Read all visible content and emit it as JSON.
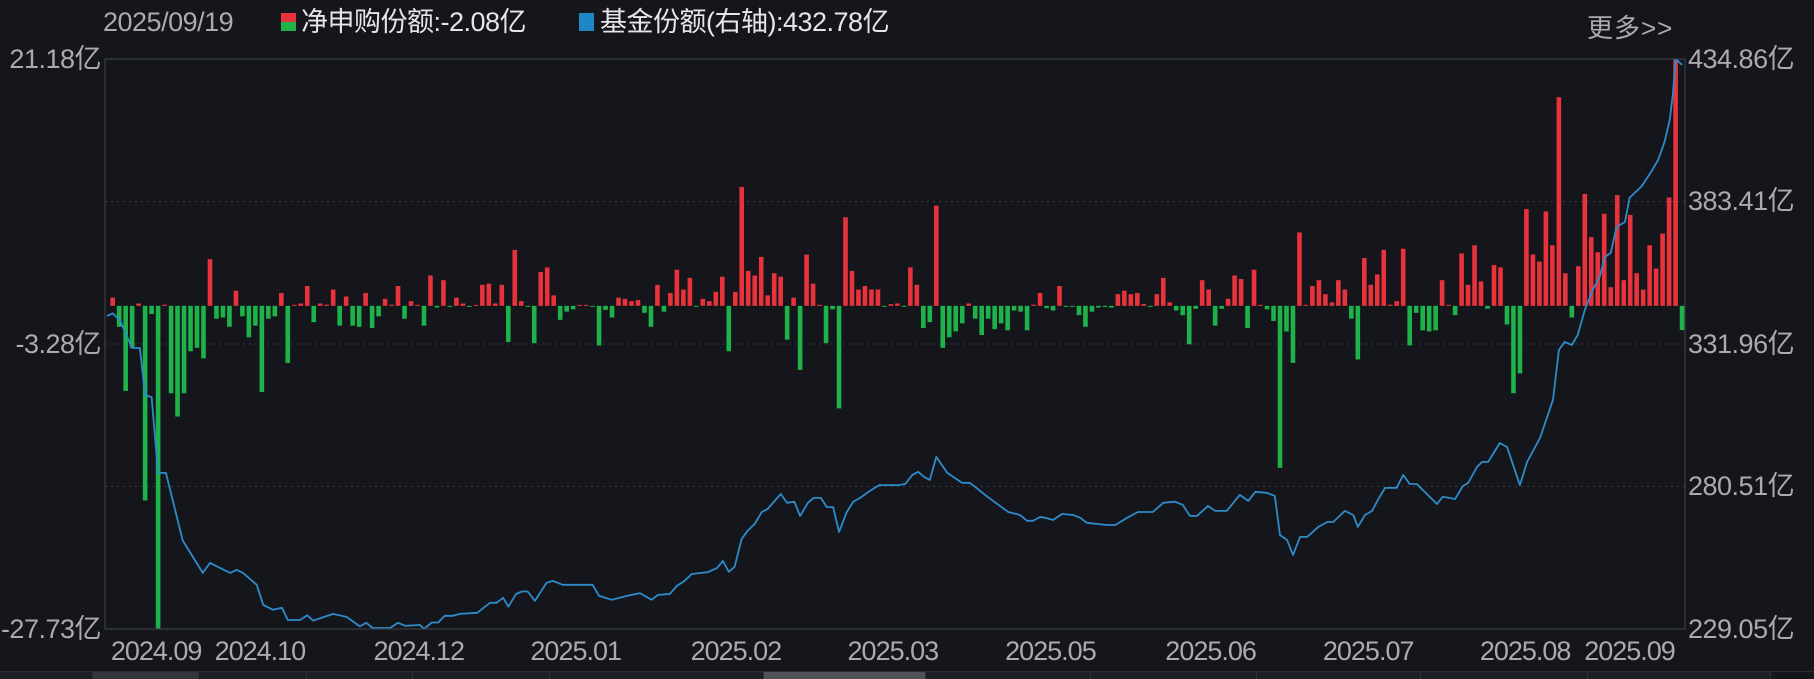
{
  "header": {
    "date": "2025/09/19",
    "net_purchase_label": "净申购份额:-2.08亿",
    "fund_share_label": "基金份额(右轴):432.78亿",
    "more_link": "更多>>"
  },
  "colors": {
    "positive": "#e8333c",
    "negative": "#1db34a",
    "line": "#2e8bc9",
    "grid": "#3a3d44",
    "background": "#14161b"
  },
  "chart_data": {
    "type": "bar+line",
    "title": "",
    "series": [
      {
        "name": "净申购份额",
        "type": "bar",
        "axis": "left",
        "unit": "亿",
        "values": [
          0.7,
          -1.8,
          -7.3,
          -3.6,
          0.2,
          -16.7,
          -0.7,
          -27.73,
          0.1,
          -7.5,
          -9.5,
          -7.5,
          -3.9,
          -3.6,
          -4.5,
          4.0,
          -1.1,
          -1.0,
          -1.8,
          1.3,
          -0.9,
          -2.7,
          -1.7,
          -7.4,
          -1.1,
          -0.9,
          1.1,
          -4.9,
          0.05,
          0.2,
          1.7,
          -1.4,
          0.2,
          0.1,
          1.4,
          -1.7,
          0.8,
          -1.7,
          -1.8,
          1.1,
          -1.9,
          -0.9,
          0.6,
          0.1,
          1.7,
          -1.1,
          0.4,
          0.05,
          -1.7,
          2.6,
          -0.15,
          2.2,
          -0.05,
          0.7,
          0.2,
          -0.05,
          0.05,
          1.8,
          1.9,
          0.2,
          1.8,
          -3.1,
          4.8,
          0.4,
          -0.05,
          -3.2,
          2.9,
          3.3,
          0.9,
          -1.2,
          -0.5,
          -0.3,
          0.05,
          0.05,
          -0.05,
          -3.4,
          -0.35,
          -1.0,
          0.7,
          0.6,
          0.4,
          0.5,
          -0.6,
          -1.8,
          1.8,
          -0.5,
          1.1,
          3.1,
          1.4,
          2.4,
          -0.05,
          0.6,
          0.4,
          1.2,
          2.5,
          -3.9,
          1.2,
          10.2,
          3.0,
          2.6,
          4.2,
          0.9,
          2.8,
          2.5,
          -2.9,
          0.7,
          -5.5,
          4.4,
          1.9,
          0.05,
          -3.2,
          -0.3,
          -8.8,
          7.6,
          3.0,
          1.4,
          1.7,
          1.4,
          1.4,
          -0.05,
          0.15,
          0.2,
          -0.05,
          3.3,
          1.8,
          -1.9,
          -1.4,
          8.6,
          -3.6,
          -2.7,
          -2.2,
          -1.5,
          0.2,
          -1.1,
          -2.5,
          -1.1,
          -2.0,
          -1.5,
          -2.1,
          -0.4,
          -0.5,
          -2.1,
          0.1,
          1.1,
          -0.2,
          -0.4,
          1.7,
          -0.05,
          -0.05,
          -0.8,
          -1.8,
          -0.5,
          -0.15,
          -0.1,
          -0.15,
          1.0,
          1.3,
          1.0,
          1.1,
          0.15,
          -0.05,
          1.0,
          2.4,
          0.3,
          -0.4,
          -0.8,
          -3.3,
          -0.25,
          2.2,
          1.4,
          -1.7,
          -0.25,
          0.6,
          2.6,
          2.3,
          -1.9,
          3.1,
          0.05,
          -0.3,
          -1.3,
          -13.9,
          -2.2,
          -4.9,
          6.3,
          0.05,
          1.7,
          2.2,
          1.0,
          0.3,
          2.2,
          1.4,
          -1.1,
          -4.6,
          4.1,
          1.8,
          2.7,
          4.8,
          0.1,
          0.4,
          4.9,
          -3.4,
          -0.6,
          -2.1,
          -2.2,
          -2.1,
          2.2,
          0.05,
          -0.8,
          4.5,
          1.8,
          5.2,
          2.1,
          -0.25,
          3.5,
          3.3,
          -1.6,
          -7.5,
          -5.8,
          8.3,
          4.4,
          3.8,
          8.1,
          5.2,
          17.9,
          2.8,
          -1.0,
          3.4,
          9.6,
          5.9,
          4.6,
          7.9,
          1.6,
          9.5,
          2.2,
          7.8,
          2.8,
          1.4,
          5.2,
          3.2,
          6.2,
          9.3,
          21.18,
          -2.08
        ]
      },
      {
        "name": "基金份额(右轴)",
        "type": "line",
        "axis": "right",
        "unit": "亿",
        "points": [
          [
            -0.9,
            342.1
          ],
          [
            0,
            343
          ],
          [
            1.1,
            340.6
          ],
          [
            3,
            330.5
          ],
          [
            4.2,
            330.5
          ],
          [
            5,
            313.5
          ],
          [
            6,
            312.8
          ],
          [
            7,
            285.4
          ],
          [
            8.2,
            285.4
          ],
          [
            10.8,
            261
          ],
          [
            13.9,
            249.3
          ],
          [
            15,
            252.9
          ],
          [
            18.1,
            249.3
          ],
          [
            19.1,
            250.4
          ],
          [
            20.1,
            249.3
          ],
          [
            22.2,
            245
          ],
          [
            23.2,
            237.8
          ],
          [
            24.7,
            236
          ],
          [
            26.1,
            236.7
          ],
          [
            27,
            232.3
          ],
          [
            28.9,
            232.3
          ],
          [
            30,
            234
          ],
          [
            30.9,
            232.1
          ],
          [
            34,
            234.5
          ],
          [
            36.1,
            233.4
          ],
          [
            38.1,
            230
          ],
          [
            39.1,
            231.3
          ],
          [
            40.1,
            229.4
          ],
          [
            42.8,
            229.4
          ],
          [
            44,
            231.3
          ],
          [
            45.1,
            230.2
          ],
          [
            47.4,
            230.5
          ],
          [
            48,
            229.1
          ],
          [
            49.2,
            231.4
          ],
          [
            50.2,
            231.4
          ],
          [
            51.2,
            233.8
          ],
          [
            52.5,
            233.8
          ],
          [
            53.5,
            234.5
          ],
          [
            56.2,
            234.9
          ],
          [
            58.2,
            238.5
          ],
          [
            59.2,
            238.5
          ],
          [
            60.2,
            240.3
          ],
          [
            61,
            237.1
          ],
          [
            62.2,
            241.7
          ],
          [
            63.1,
            242.6
          ],
          [
            64,
            242.6
          ],
          [
            65.1,
            239.2
          ],
          [
            66.9,
            245.7
          ],
          [
            67.9,
            246.4
          ],
          [
            69.4,
            245
          ],
          [
            74,
            245
          ],
          [
            75,
            241
          ],
          [
            77,
            239.6
          ],
          [
            79.3,
            241
          ],
          [
            81.3,
            242
          ],
          [
            83.1,
            239.6
          ],
          [
            84.1,
            241.4
          ],
          [
            85.9,
            241.7
          ],
          [
            87,
            244.6
          ],
          [
            88.2,
            246.5
          ],
          [
            89.3,
            248.9
          ],
          [
            91.8,
            249.6
          ],
          [
            93.2,
            251.1
          ],
          [
            94.1,
            253.6
          ],
          [
            95,
            249.7
          ],
          [
            95.9,
            251.5
          ],
          [
            97,
            261.6
          ],
          [
            97.9,
            264.5
          ],
          [
            99,
            267
          ],
          [
            100.1,
            271.3
          ],
          [
            101,
            272.4
          ],
          [
            103,
            277.8
          ],
          [
            104,
            274.6
          ],
          [
            105.1,
            275
          ],
          [
            106,
            269.9
          ],
          [
            107.2,
            274.6
          ],
          [
            108.1,
            276.4
          ],
          [
            109.2,
            276.4
          ],
          [
            110.1,
            273.1
          ],
          [
            111.1,
            273
          ],
          [
            112,
            264.1
          ],
          [
            113.2,
            271.3
          ],
          [
            114.2,
            275
          ],
          [
            115.2,
            276.3
          ],
          [
            116.5,
            278.5
          ],
          [
            118.2,
            281
          ],
          [
            121.1,
            281
          ],
          [
            122.2,
            281.4
          ],
          [
            123.3,
            284.7
          ],
          [
            124.2,
            285.8
          ],
          [
            125.1,
            284
          ],
          [
            126,
            282.9
          ],
          [
            127,
            291.2
          ],
          [
            128.7,
            285.4
          ],
          [
            131,
            281.8
          ],
          [
            132.2,
            281.8
          ],
          [
            133.4,
            279.6
          ],
          [
            134.9,
            276.8
          ],
          [
            138.1,
            271.3
          ],
          [
            139.9,
            270.2
          ],
          [
            141,
            268.1
          ],
          [
            141.9,
            268.1
          ],
          [
            143,
            269.5
          ],
          [
            143.8,
            269.2
          ],
          [
            145,
            268.4
          ],
          [
            146.4,
            270.6
          ],
          [
            148.1,
            270.2
          ],
          [
            149.2,
            269.2
          ],
          [
            150.2,
            267.4
          ],
          [
            153.3,
            266.6
          ],
          [
            154.6,
            266.6
          ],
          [
            156.4,
            269.2
          ],
          [
            158.1,
            271.3
          ],
          [
            160.4,
            271.3
          ],
          [
            162,
            274.6
          ],
          [
            163.8,
            275
          ],
          [
            165,
            273.9
          ],
          [
            166.1,
            269.9
          ],
          [
            167.2,
            269.9
          ],
          [
            168.9,
            273.5
          ],
          [
            170,
            271.7
          ],
          [
            171.8,
            271.7
          ],
          [
            173.8,
            277.5
          ],
          [
            175.1,
            275.3
          ],
          [
            176.2,
            278.6
          ],
          [
            178,
            278.2
          ],
          [
            179.2,
            277.1
          ],
          [
            180,
            263
          ],
          [
            181.1,
            261.2
          ],
          [
            182,
            255.8
          ],
          [
            183.1,
            262.3
          ],
          [
            184.2,
            262.3
          ],
          [
            185.9,
            265.9
          ],
          [
            187.3,
            267.7
          ],
          [
            188.2,
            267.7
          ],
          [
            190,
            271.7
          ],
          [
            191.3,
            270.2
          ],
          [
            192,
            265.9
          ],
          [
            193.1,
            270.2
          ],
          [
            194.2,
            271.7
          ],
          [
            195.1,
            275.7
          ],
          [
            196.2,
            280
          ],
          [
            198,
            280
          ],
          [
            199,
            284.7
          ],
          [
            200,
            281.4
          ],
          [
            201.1,
            281.4
          ],
          [
            204.2,
            274.2
          ],
          [
            205.1,
            276.8
          ],
          [
            207,
            276
          ],
          [
            208.2,
            280.7
          ],
          [
            209,
            281.8
          ],
          [
            210.4,
            287.6
          ],
          [
            211.2,
            289.4
          ],
          [
            212.1,
            289.4
          ],
          [
            213.9,
            296.2
          ],
          [
            215,
            294.8
          ],
          [
            217,
            281
          ],
          [
            218.1,
            289.4
          ],
          [
            220.1,
            298
          ],
          [
            222.1,
            311.8
          ],
          [
            223,
            329.8
          ],
          [
            223.9,
            332.7
          ],
          [
            225,
            331.6
          ],
          [
            225.9,
            335.2
          ],
          [
            227,
            344.2
          ],
          [
            228.2,
            351.5
          ],
          [
            229.3,
            356.2
          ],
          [
            230.1,
            363.4
          ],
          [
            231,
            364.8
          ],
          [
            231.9,
            374.2
          ],
          [
            233.2,
            376
          ],
          [
            233.9,
            384.7
          ],
          [
            235.8,
            389
          ],
          [
            237.3,
            394.4
          ],
          [
            238.3,
            398.4
          ],
          [
            239.3,
            405
          ],
          [
            240.1,
            412.8
          ],
          [
            240.6,
            422.6
          ],
          [
            241,
            434.86
          ],
          [
            242,
            432.78
          ]
        ]
      }
    ],
    "left_axis": {
      "ylim": [
        -27.73,
        21.18
      ],
      "tick_labels": [
        "21.18亿",
        "-3.28亿",
        "-27.73亿"
      ],
      "tick_values": [
        21.18,
        -3.28,
        -27.73
      ]
    },
    "right_axis": {
      "ylim": [
        229.05,
        434.86
      ],
      "tick_labels": [
        "434.86亿",
        "383.41亿",
        "331.96亿",
        "280.51亿",
        "229.05亿"
      ],
      "tick_values": [
        434.86,
        383.41,
        331.96,
        280.51,
        229.05
      ]
    },
    "x_axis": {
      "tick_labels": [
        "2024.09",
        "2024.10",
        "2024.12",
        "2025.01",
        "2025.02",
        "2025.03",
        "2025.05",
        "2025.06",
        "2025.07",
        "2025.08",
        "2025.09"
      ],
      "tick_index": [
        6.7,
        22.7,
        47.2,
        71.4,
        96.1,
        120.3,
        144.6,
        169.3,
        193.6,
        217.8,
        233.9
      ],
      "count": 243
    },
    "grid": "horizontal dotted",
    "legend_placement": "top-left"
  },
  "bottom_tabs": {
    "count": 12,
    "active_index": 6
  }
}
